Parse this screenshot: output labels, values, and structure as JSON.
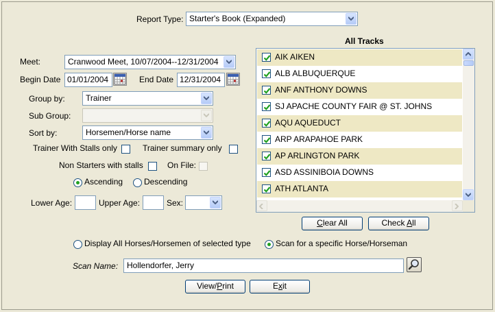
{
  "report_type": {
    "label": "Report Type:",
    "value": "Starter's Book (Expanded)"
  },
  "meet": {
    "label": "Meet:",
    "value": "Cranwood Meet, 10/07/2004--12/31/2004"
  },
  "begin_date": {
    "label": "Begin Date",
    "value": "01/01/2004"
  },
  "end_date": {
    "label": "End Date",
    "value": "12/31/2004"
  },
  "group_by": {
    "label": "Group by:",
    "value": "Trainer"
  },
  "sub_group": {
    "label": "Sub Group:",
    "value": ""
  },
  "sort_by": {
    "label": "Sort by:",
    "value": "Horsemen/Horse name"
  },
  "options": {
    "trainer_with_stalls": "Trainer With Stalls only",
    "trainer_summary": "Trainer summary only",
    "non_starters": "Non Starters with stalls",
    "on_file": "On File:"
  },
  "order": {
    "ascending": "Ascending",
    "descending": "Descending",
    "selected": "ascending"
  },
  "age": {
    "lower_label": "Lower Age:",
    "lower_value": "",
    "upper_label": "Upper Age:",
    "upper_value": "",
    "sex_label": "Sex:",
    "sex_value": ""
  },
  "tracks": {
    "title": "All Tracks",
    "items": [
      {
        "label": "AIK AIKEN",
        "checked": true
      },
      {
        "label": "ALB ALBUQUERQUE",
        "checked": true
      },
      {
        "label": "ANF ANTHONY DOWNS",
        "checked": true
      },
      {
        "label": "SJ APACHE COUNTY FAIR @ ST. JOHNS",
        "checked": true
      },
      {
        "label": "AQU AQUEDUCT",
        "checked": true
      },
      {
        "label": "ARP ARAPAHOE PARK",
        "checked": true
      },
      {
        "label": "AP ARLINGTON PARK",
        "checked": true
      },
      {
        "label": "ASD ASSINIBOIA DOWNS",
        "checked": true
      },
      {
        "label": "ATH ATLANTA",
        "checked": true
      }
    ],
    "clear_all": "Clear All",
    "check_all": "Check All"
  },
  "scan_mode": {
    "all_label": "Display All Horses/Horsemen of selected type",
    "specific_label": "Scan for a specific Horse/Horseman",
    "selected": "specific"
  },
  "scan_name": {
    "label": "Scan Name:",
    "value": "Hollendorfer, Jerry"
  },
  "buttons": {
    "view_print": "View/Print",
    "exit": "Exit"
  },
  "colors": {
    "row_highlight": "#EEE8C4",
    "checkmark": "#21A121",
    "background": "#ECE9D8"
  },
  "icons": [
    "calendar-icon",
    "search-icon",
    "chevron-down-icon",
    "checkmark-icon"
  ]
}
